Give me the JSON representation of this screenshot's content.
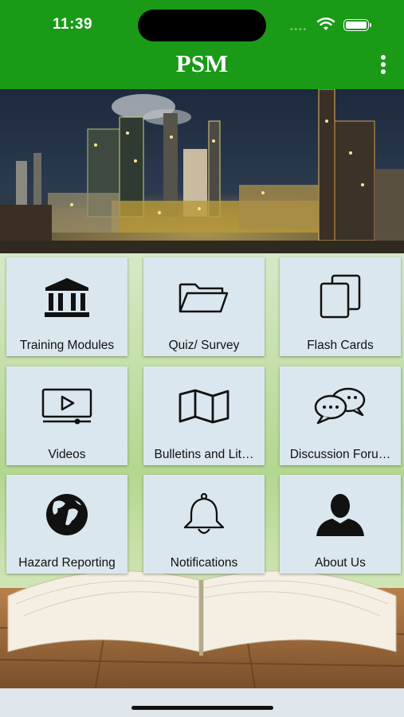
{
  "status": {
    "time": "11:39"
  },
  "app": {
    "title": "PSM"
  },
  "colors": {
    "brand_green": "#1a9a17",
    "tile_bg": "#dbe7ee"
  },
  "tiles": [
    {
      "label": "Training Modules",
      "icon": "bank-icon"
    },
    {
      "label": "Quiz/ Survey",
      "icon": "folder-icon"
    },
    {
      "label": "Flash Cards",
      "icon": "cards-icon"
    },
    {
      "label": "Videos",
      "icon": "video-player-icon"
    },
    {
      "label": "Bulletins and Lit…",
      "icon": "map-icon"
    },
    {
      "label": "Discussion Foru…",
      "icon": "chat-bubbles-icon"
    },
    {
      "label": "Hazard Reporting",
      "icon": "globe-icon"
    },
    {
      "label": "Notifications",
      "icon": "bell-icon"
    },
    {
      "label": "About Us",
      "icon": "user-icon"
    }
  ]
}
